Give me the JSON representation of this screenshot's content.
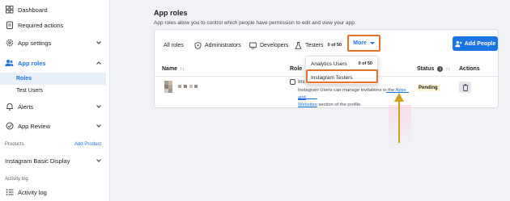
{
  "sidebar": {
    "dashboard": "Dashboard",
    "required_actions": "Required actions",
    "app_settings": "App settings",
    "app_roles": "App roles",
    "roles": "Roles",
    "test_users": "Test Users",
    "alerts": "Alerts",
    "app_review": "App Review",
    "products_label": "Products",
    "add_product": "Add Product",
    "instagram_basic_display": "Instagram Basic Display",
    "activity_log_label": "Activity log",
    "activity_log": "Activity log"
  },
  "main": {
    "title": "App roles",
    "subtitle": "App roles allow you to control which people have permission to edit and view your app.",
    "tabs": {
      "all_roles": "All roles",
      "administrators": "Administrators",
      "developers": "Developers",
      "testers": "Testers",
      "testers_count": "0 of 50",
      "more": "More"
    },
    "add_people": "Add People",
    "table": {
      "col_name": "Name",
      "col_role": "Role",
      "col_status": "Status",
      "col_actions": "Actions",
      "sort_glyph": "↑↓",
      "info_glyph": "i"
    },
    "row": {
      "role": "Instagram Testers",
      "role_visible": "Instag",
      "desc_prefix": "Instagram Users can manage invitations in the ",
      "desc_link1": "Apps and",
      "desc_link2": "Websites",
      "desc_suffix": " section of the profile.",
      "status": "Pending"
    },
    "dropdown": {
      "analytics_users": "Analytics Users",
      "analytics_count": "0 of 50",
      "instagram_testers": "Instagram Testers"
    }
  },
  "colors": {
    "accent": "#1b74e4",
    "highlight": "#e8722c",
    "arrow": "#d4a017",
    "pending_bg": "#fff4cc"
  }
}
